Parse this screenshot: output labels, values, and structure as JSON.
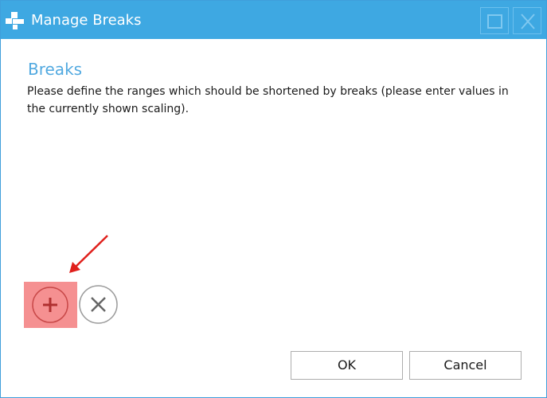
{
  "window": {
    "title": "Manage Breaks",
    "accent_color": "#3ea8e2",
    "icons": {
      "app": "app-icon",
      "maximize": "maximize-icon",
      "close": "close-icon"
    }
  },
  "content": {
    "heading": "Breaks",
    "description": "Please define the ranges which should be shortened by breaks (please enter values in the currently shown scaling)."
  },
  "toolbar": {
    "add_icon": "plus-circle-icon",
    "remove_icon": "x-circle-icon",
    "highlight_color": "#f59091",
    "annotation_arrow_color": "#e0201c"
  },
  "buttons": {
    "ok_label": "OK",
    "cancel_label": "Cancel"
  }
}
